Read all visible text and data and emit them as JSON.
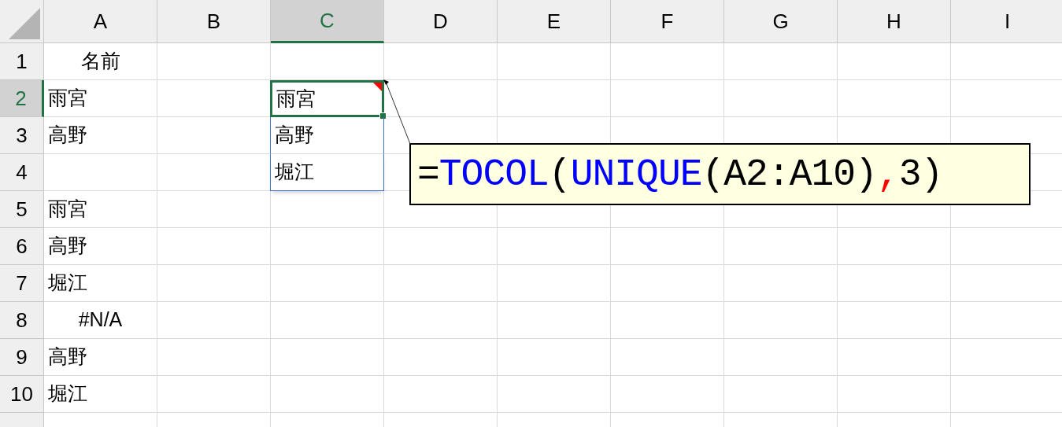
{
  "columns": [
    {
      "label": "A",
      "selected": false
    },
    {
      "label": "B",
      "selected": false
    },
    {
      "label": "C",
      "selected": true
    },
    {
      "label": "D",
      "selected": false
    },
    {
      "label": "E",
      "selected": false
    },
    {
      "label": "F",
      "selected": false
    },
    {
      "label": "G",
      "selected": false
    },
    {
      "label": "H",
      "selected": false
    },
    {
      "label": "I",
      "selected": false
    }
  ],
  "rows": [
    {
      "label": "1",
      "selected": false,
      "A": {
        "text": "名前",
        "kind": "heading"
      }
    },
    {
      "label": "2",
      "selected": true,
      "A": {
        "text": "雨宮",
        "kind": "text"
      },
      "C": {
        "text": "雨宮",
        "kind": "text",
        "active": true,
        "note": true
      }
    },
    {
      "label": "3",
      "selected": false,
      "A": {
        "text": "高野",
        "kind": "text"
      },
      "C": {
        "text": "高野",
        "kind": "text",
        "active": false,
        "note": false
      }
    },
    {
      "label": "4",
      "selected": false,
      "C": {
        "text": "堀江",
        "kind": "text",
        "active": false,
        "note": false
      }
    },
    {
      "label": "5",
      "selected": false,
      "A": {
        "text": "雨宮",
        "kind": "text"
      }
    },
    {
      "label": "6",
      "selected": false,
      "A": {
        "text": "高野",
        "kind": "text"
      }
    },
    {
      "label": "7",
      "selected": false,
      "A": {
        "text": "堀江",
        "kind": "text"
      }
    },
    {
      "label": "8",
      "selected": false,
      "A": {
        "text": "#N/A",
        "kind": "error"
      }
    },
    {
      "label": "9",
      "selected": false,
      "A": {
        "text": "高野",
        "kind": "text"
      }
    },
    {
      "label": "10",
      "selected": false,
      "A": {
        "text": "堀江",
        "kind": "text"
      }
    }
  ],
  "callout": {
    "segments": [
      {
        "text": "=",
        "color": "#000000"
      },
      {
        "text": "TOCOL",
        "color": "#0000ff"
      },
      {
        "text": "(",
        "color": "#000000"
      },
      {
        "text": "UNIQUE",
        "color": "#0000ff"
      },
      {
        "text": "(A2:A10)",
        "color": "#000000"
      },
      {
        "text": ",",
        "color": "#ff0000"
      },
      {
        "text": "3)",
        "color": "#000000"
      }
    ]
  }
}
